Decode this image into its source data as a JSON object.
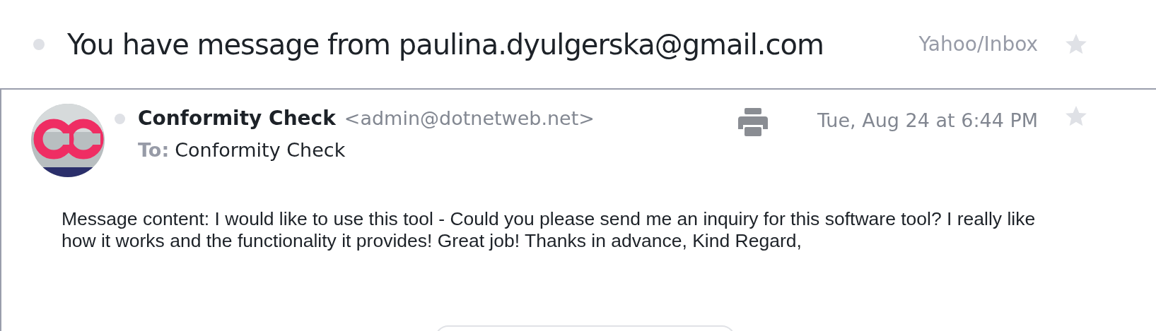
{
  "subject": {
    "text": "You have message from paulina.dyulgerska@gmail.com",
    "folder": "Yahoo/Inbox",
    "starred": false
  },
  "message": {
    "sender_name": "Conformity Check",
    "sender_email": "<admin@dotnetweb.net>",
    "to_label": "To:",
    "to": "Conformity Check",
    "date": "Tue, Aug 24 at 6:44 PM",
    "starred": false,
    "body": "Message content: I would like to use this tool - Could you please send me an inquiry for this software tool? I really like how it works and the functionality it provides! Great job! Thanks in advance, Kind Regard,"
  }
}
